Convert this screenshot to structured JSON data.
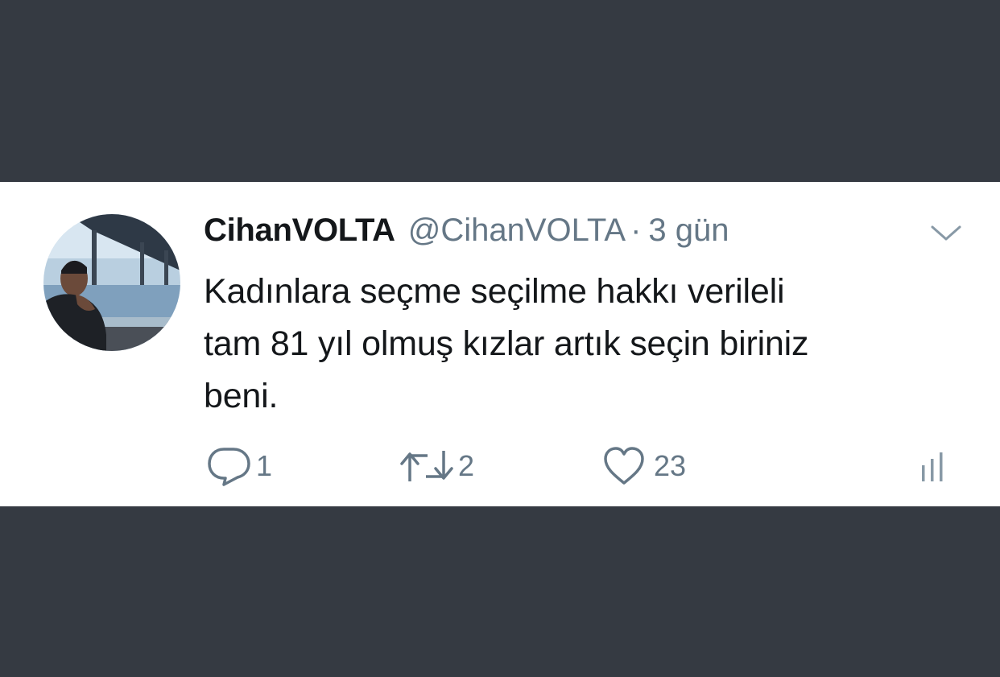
{
  "tweet": {
    "display_name": "CihanVOLTA",
    "handle": "@CihanVOLTA",
    "separator": "·",
    "time": "3 gün",
    "text_lines": [
      "Kadınlara seçme seçilme hakkı verileli",
      "tam 81 yıl olmuş kızlar artık seçin biriniz",
      "beni."
    ]
  },
  "actions": {
    "reply": {
      "icon": "reply-icon",
      "count": "1"
    },
    "retweet": {
      "icon": "retweet-icon",
      "count": "2"
    },
    "like": {
      "icon": "heart-icon",
      "count": "23"
    },
    "stats": {
      "icon": "analytics-icon"
    }
  },
  "menu": {
    "icon": "chevron-down-icon"
  },
  "colors": {
    "background": "#353a42",
    "card": "#ffffff",
    "text": "#14171a",
    "secondary": "#657786"
  }
}
